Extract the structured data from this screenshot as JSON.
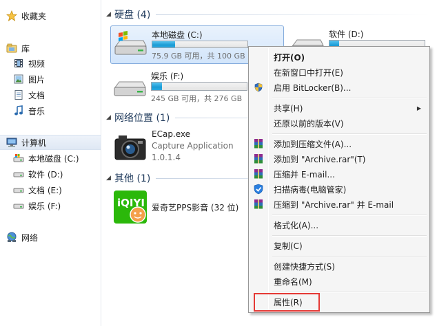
{
  "nav": {
    "favorites": "收藏夹",
    "libraries": "库",
    "videos": "视频",
    "pictures": "图片",
    "documents": "文档",
    "music": "音乐",
    "computer": "计算机",
    "drives": [
      "本地磁盘 (C:)",
      "软件 (D:)",
      "文档 (E:)",
      "娱乐 (F:)"
    ],
    "network": "网络"
  },
  "groups": {
    "hdd": "硬盘 (4)",
    "netloc": "网络位置 (1)",
    "other": "其他 (1)"
  },
  "drives": {
    "c": {
      "name": "本地磁盘 (C:)",
      "size": "75.9 GB 可用，共 100 GB",
      "used_fraction": 0.24
    },
    "d": {
      "name": "软件 (D:)",
      "used_fraction": 0.1
    },
    "f": {
      "name": "娱乐 (F:)",
      "size": "245 GB 可用，共 276 GB",
      "used_fraction": 0.11
    }
  },
  "apps": {
    "ecap": {
      "name": "ECap.exe",
      "desc": "Capture Application",
      "version": "1.0.1.4"
    },
    "iqiyi": {
      "name": "爱奇艺PPS影音 (32 位)"
    }
  },
  "menu": {
    "open": "打开(O)",
    "open_new": "在新窗口中打开(E)",
    "bitlocker": "启用 BitLocker(B)...",
    "share": "共享(H)",
    "restore": "还原以前的版本(V)",
    "add_archive": "添加到压缩文件(A)...",
    "add_rar": "添加到 \"Archive.rar\"(T)",
    "compress_email": "压缩并 E-mail...",
    "scan": "扫描病毒(电脑管家)",
    "compress_rar_email": "压缩到 \"Archive.rar\" 并 E-mail",
    "format": "格式化(A)...",
    "copy": "复制(C)",
    "shortcut": "创建快捷方式(S)",
    "rename": "重命名(M)",
    "properties": "属性(R)"
  },
  "colors": {
    "accent": "#1b9bd5",
    "highlight": "#e53935",
    "group_title": "#1e395b"
  }
}
